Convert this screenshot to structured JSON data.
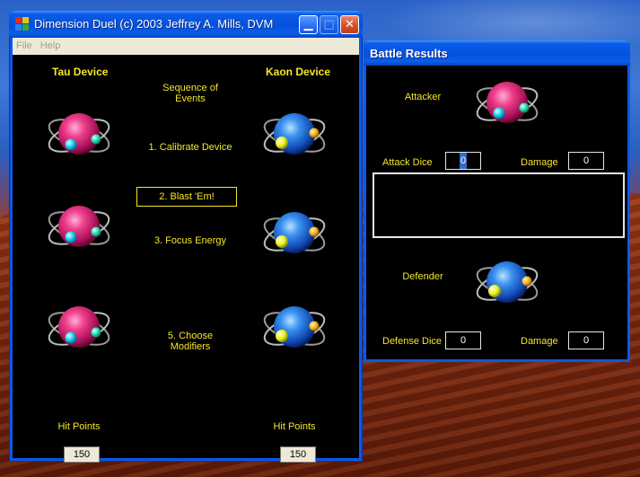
{
  "main_window": {
    "title": "Dimension Duel (c) 2003 Jeffrey A. Mills, DVM",
    "menu": [
      "File",
      "Help"
    ],
    "tau_header": "Tau Device",
    "kaon_header": "Kaon Device",
    "sequence_label": "Sequence of Events",
    "steps": {
      "calibrate": "1. Calibrate Device",
      "blast": "2. Blast 'Em!",
      "focus": "3. Focus Energy",
      "modifiers": "5. Choose Modifiers"
    },
    "tau_hp_label": "Hit Points",
    "tau_hp_value": "150",
    "kaon_hp_label": "Hit Points",
    "kaon_hp_value": "150"
  },
  "battle_window": {
    "title": "Battle Results",
    "attacker_label": "Attacker",
    "defender_label": "Defender",
    "attack_dice_label": "Attack Dice",
    "attack_dice_value": "0",
    "attack_damage_label": "Damage",
    "attack_damage_value": "0",
    "defense_dice_label": "Defense Dice",
    "defense_dice_value": "0",
    "defense_damage_label": "Damage",
    "defense_damage_value": "0",
    "log": ""
  },
  "colors": {
    "label_yellow": "#f5e62a",
    "tau_magenta": "#e0307a",
    "kaon_blue": "#2a7ae0",
    "xp_blue": "#0a58e8"
  },
  "icons": [
    "tau-atom-icon",
    "kaon-atom-icon"
  ]
}
